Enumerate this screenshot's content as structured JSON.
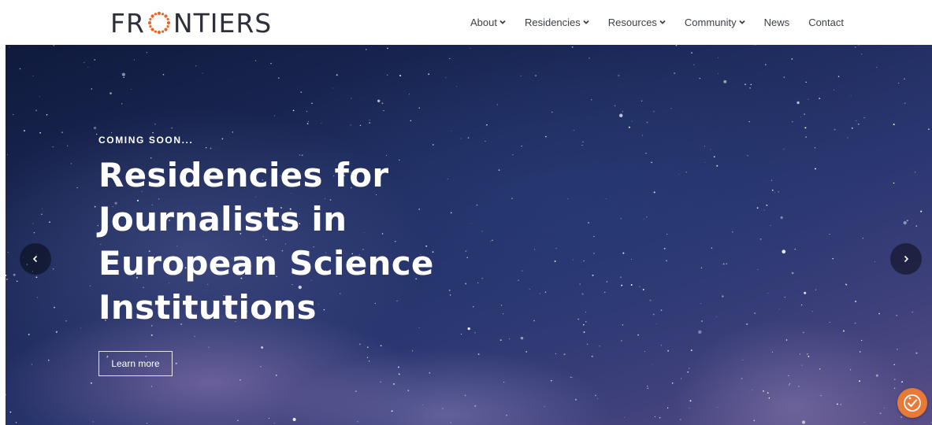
{
  "brand": {
    "name_left": "FR",
    "name_right": "NTIERS",
    "logo_mark_color": "#e8642a",
    "text_color": "#2d2f3b"
  },
  "nav": {
    "items": [
      {
        "label": "About",
        "has_dropdown": true
      },
      {
        "label": "Residencies",
        "has_dropdown": true
      },
      {
        "label": "Resources",
        "has_dropdown": true
      },
      {
        "label": "Community",
        "has_dropdown": true
      },
      {
        "label": "News",
        "has_dropdown": false
      },
      {
        "label": "Contact",
        "has_dropdown": false
      }
    ]
  },
  "hero": {
    "eyebrow": "COMING SOON...",
    "title_lines": [
      "Residencies for",
      "Journalists in",
      "European Science",
      "Institutions"
    ],
    "cta_label": "Learn more"
  },
  "colors": {
    "accent": "#e87a35",
    "hero_dark": "#0f1a3c"
  },
  "icons": {
    "prev": "chevron-left-icon",
    "next": "chevron-right-icon",
    "accessibility": "accessibility-check-icon",
    "dropdown": "chevron-down-icon"
  }
}
